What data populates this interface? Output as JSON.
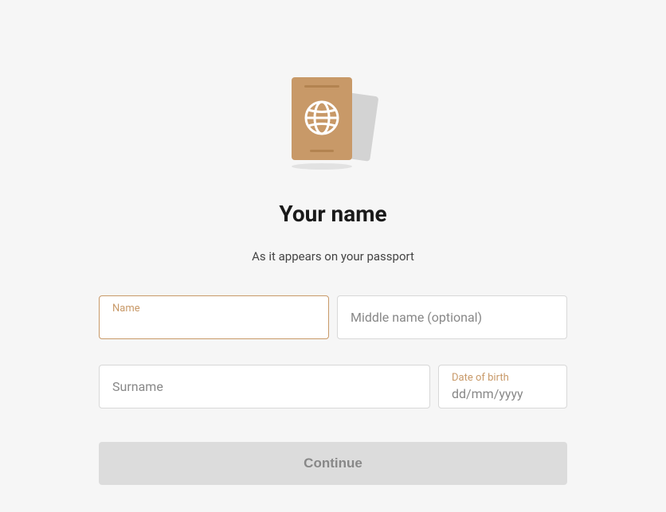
{
  "header": {
    "title": "Your name",
    "subtitle": "As it appears on your passport"
  },
  "fields": {
    "name": {
      "label": "Name",
      "value": ""
    },
    "middle": {
      "placeholder": "Middle name (optional)",
      "value": ""
    },
    "surname": {
      "placeholder": "Surname",
      "value": ""
    },
    "dob": {
      "label": "Date of birth",
      "placeholder": "dd/mm/yyyy",
      "value": ""
    }
  },
  "actions": {
    "continue_label": "Continue"
  }
}
